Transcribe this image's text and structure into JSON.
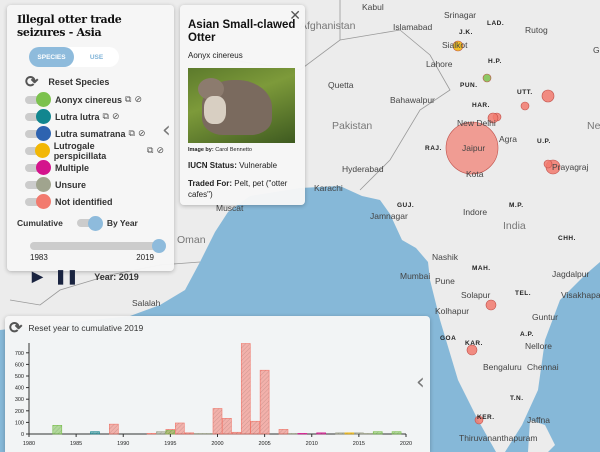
{
  "legend": {
    "title": "Illegal otter trade seizures - Asia",
    "tabs": [
      {
        "label": "SPECIES",
        "active": true
      },
      {
        "label": "USE",
        "active": false
      }
    ],
    "reset_label": "Reset Species",
    "species": [
      {
        "label": "Aonyx cinereus",
        "color": "#7cc24e",
        "links": true
      },
      {
        "label": "Lutra lutra",
        "color": "#11868f",
        "links": true
      },
      {
        "label": "Lutra sumatrana",
        "color": "#2e63b0",
        "links": true
      },
      {
        "label": "Lutrogale perspicillata",
        "color": "#f2b705",
        "links": true
      },
      {
        "label": "Multiple",
        "color": "#d4148c",
        "links": false
      },
      {
        "label": "Unsure",
        "color": "#a0a48e",
        "links": false
      },
      {
        "label": "Not identified",
        "color": "#f27a6e",
        "links": false
      }
    ],
    "mode_left": "Cumulative",
    "mode_right": "By Year",
    "slider_min": "1983",
    "slider_max": "2019",
    "slider_value_fraction": 1.0,
    "year_label": "Year: 2019"
  },
  "popup": {
    "title": "Asian Small-clawed Otter",
    "scientific": "Aonyx cinereus",
    "image_credit_label": "Image by:",
    "image_credit": "Carol Bennetto",
    "status_label": "IUCN Status:",
    "status": "Vulnerable",
    "traded_label": "Traded For:",
    "traded": "Pelt, pet (\"otter cafes\")"
  },
  "map": {
    "countries": [
      {
        "t": "Afghanistan"
      },
      {
        "t": "Pakistan"
      },
      {
        "t": "Oman"
      },
      {
        "t": "India"
      },
      {
        "t": "Nep"
      }
    ],
    "cities": [
      "Kabul",
      "Islamabad",
      "Srinagar",
      "Rutog",
      "Sialkot",
      "Lahore",
      "Quetta",
      "Bahawalpur",
      "New Delhi",
      "Agra",
      "Jaipur",
      "Kota",
      "Prayagraj",
      "Hyderabad",
      "Karachi",
      "Jamnagar",
      "Indore",
      "Muscat",
      "Salalah",
      "Nashik",
      "Mumbai",
      "Pune",
      "Solapur",
      "Jagdalpur",
      "Visakhapatn",
      "Kolhapur",
      "Guntur",
      "Nellore",
      "Bengaluru",
      "Chennai",
      "Jaffna",
      "Thiruvananthapuram",
      "Gé"
    ],
    "states": [
      "LAD.",
      "J.K.",
      "H.P.",
      "PUN.",
      "UTT.",
      "HAR.",
      "U.P.",
      "RAJ.",
      "GUJ.",
      "M.P.",
      "CHH.",
      "MAH.",
      "TEL.",
      "GOA",
      "KAR.",
      "A.P.",
      "T.N.",
      "KER."
    ]
  },
  "chart_data": {
    "type": "bar",
    "title": "Reset year to cumulative 2019",
    "xlim": [
      1980,
      2020
    ],
    "ylim": [
      0,
      780
    ],
    "xticks": [
      "1980",
      "1985",
      "1990",
      "1995",
      "2000",
      "2005",
      "2010",
      "2015",
      "2020"
    ],
    "yticks": [
      "0",
      "100",
      "200",
      "300",
      "400",
      "500",
      "600",
      "700"
    ],
    "bars": [
      {
        "x": 1983,
        "v": 75,
        "c": "#7cc24e"
      },
      {
        "x": 1987,
        "v": 20,
        "c": "#11868f"
      },
      {
        "x": 1989,
        "v": 85,
        "c": "#f27a6e"
      },
      {
        "x": 1993,
        "v": 5,
        "c": "#f27a6e"
      },
      {
        "x": 1994,
        "v": 20,
        "c": "#a0a48e"
      },
      {
        "x": 1995,
        "v": 40,
        "c": "#f27a6e"
      },
      {
        "x": 1995,
        "v": 30,
        "c": "#7cc24e"
      },
      {
        "x": 1996,
        "v": 95,
        "c": "#f27a6e"
      },
      {
        "x": 1997,
        "v": 10,
        "c": "#f27a6e"
      },
      {
        "x": 1998,
        "v": 5,
        "c": "#a0a48e"
      },
      {
        "x": 1999,
        "v": 5,
        "c": "#a0a48e"
      },
      {
        "x": 2000,
        "v": 220,
        "c": "#f27a6e"
      },
      {
        "x": 2001,
        "v": 135,
        "c": "#f27a6e"
      },
      {
        "x": 2002,
        "v": 15,
        "c": "#f27a6e"
      },
      {
        "x": 2003,
        "v": 780,
        "c": "#f27a6e"
      },
      {
        "x": 2004,
        "v": 110,
        "c": "#f27a6e"
      },
      {
        "x": 2005,
        "v": 550,
        "c": "#f27a6e"
      },
      {
        "x": 2007,
        "v": 40,
        "c": "#f27a6e"
      },
      {
        "x": 2008,
        "v": 5,
        "c": "#a0a48e"
      },
      {
        "x": 2009,
        "v": 5,
        "c": "#d4148c"
      },
      {
        "x": 2011,
        "v": 10,
        "c": "#d4148c"
      },
      {
        "x": 2013,
        "v": 10,
        "c": "#a0a48e"
      },
      {
        "x": 2014,
        "v": 10,
        "c": "#f2b705"
      },
      {
        "x": 2015,
        "v": 10,
        "c": "#a0a48e"
      },
      {
        "x": 2016,
        "v": 5,
        "c": "#a0a48e"
      },
      {
        "x": 2017,
        "v": 20,
        "c": "#7cc24e"
      },
      {
        "x": 2019,
        "v": 20,
        "c": "#7cc24e"
      }
    ]
  }
}
